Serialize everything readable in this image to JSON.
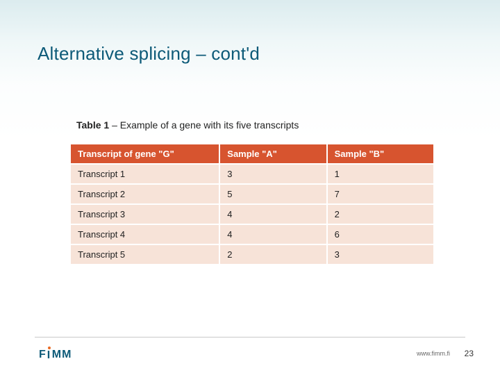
{
  "title": "Alternative splicing – cont'd",
  "caption_bold": "Table 1",
  "caption_rest": " – Example of a gene with its five transcripts",
  "table": {
    "headers": [
      "Transcript of gene \"G\"",
      "Sample \"A\"",
      "Sample \"B\""
    ],
    "rows": [
      [
        "Transcript 1",
        "3",
        "1"
      ],
      [
        "Transcript 2",
        "5",
        "7"
      ],
      [
        "Transcript 3",
        "4",
        "2"
      ],
      [
        "Transcript 4",
        "4",
        "6"
      ],
      [
        "Transcript 5",
        "2",
        "3"
      ]
    ]
  },
  "logo_text_pre": "F",
  "logo_text_post": "MM",
  "footer_url": "www.fimm.fi",
  "page_number": "23",
  "chart_data": {
    "type": "table",
    "title": "Table 1 – Example of a gene with its five transcripts",
    "columns": [
      "Transcript of gene \"G\"",
      "Sample \"A\"",
      "Sample \"B\""
    ],
    "rows": [
      {
        "Transcript of gene \"G\"": "Transcript 1",
        "Sample \"A\"": 3,
        "Sample \"B\"": 1
      },
      {
        "Transcript of gene \"G\"": "Transcript 2",
        "Sample \"A\"": 5,
        "Sample \"B\"": 7
      },
      {
        "Transcript of gene \"G\"": "Transcript 3",
        "Sample \"A\"": 4,
        "Sample \"B\"": 2
      },
      {
        "Transcript of gene \"G\"": "Transcript 4",
        "Sample \"A\"": 4,
        "Sample \"B\"": 6
      },
      {
        "Transcript of gene \"G\"": "Transcript 5",
        "Sample \"A\"": 2,
        "Sample \"B\"": 3
      }
    ]
  }
}
